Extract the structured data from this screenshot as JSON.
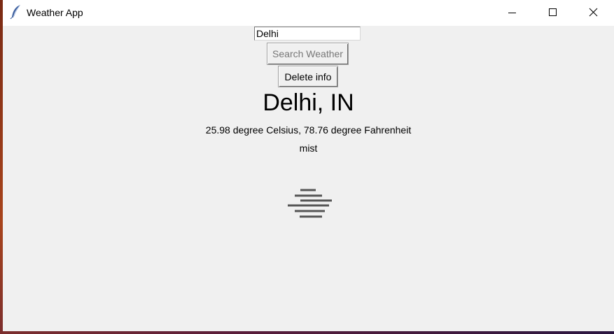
{
  "window": {
    "title": "Weather App",
    "icon": "feather-icon",
    "controls": [
      "minimize-icon",
      "maximize-icon",
      "close-icon"
    ]
  },
  "search": {
    "city_value": "Delhi",
    "search_button_label": "Search Weather",
    "delete_button_label": "Delete info"
  },
  "weather": {
    "location": "Delhi, IN",
    "temperature": "25.98 degree Celsius, 78.76 degree Fahrenheit",
    "condition": "mist",
    "icon": "mist-icon"
  }
}
